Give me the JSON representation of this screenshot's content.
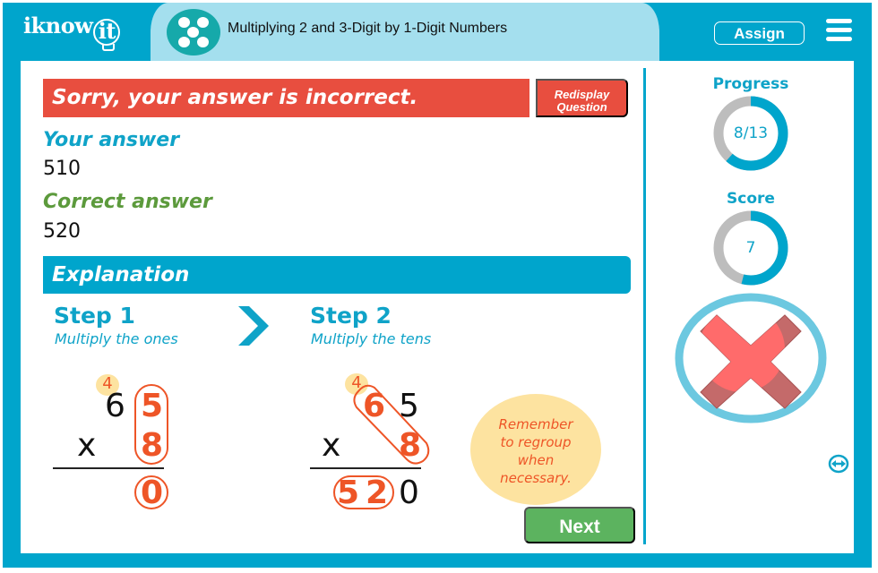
{
  "header": {
    "logo_text": "iknow",
    "logo_bulb_text": "it",
    "topic_title": "Multiplying 2 and 3-Digit by 1-Digit Numbers",
    "topic_icon": "five-dots-icon",
    "assign_label": "Assign",
    "menu_icon": "hamburger-menu-icon"
  },
  "feedback": {
    "banner_text": "Sorry, your answer is incorrect.",
    "redisplay_label_line1": "Redisplay",
    "redisplay_label_line2": "Question",
    "your_answer_label": "Your answer",
    "your_answer_value": "510",
    "correct_answer_label": "Correct answer",
    "correct_answer_value": "520"
  },
  "explanation": {
    "title": "Explanation",
    "steps": [
      {
        "title": "Step 1",
        "subtitle": "Multiply the ones",
        "carry": "4",
        "top_digits": [
          "6",
          "5"
        ],
        "operator": "x",
        "bottom_digit": "8",
        "result_digits": [
          "0"
        ]
      },
      {
        "title": "Step 2",
        "subtitle": "Multiply the tens",
        "carry": "4",
        "top_digits": [
          "6",
          "5"
        ],
        "operator": "x",
        "bottom_digit": "8",
        "result_digits": [
          "5",
          "2",
          "0"
        ]
      }
    ],
    "reminder_lines": [
      "Remember",
      "to regroup",
      "when",
      "necessary."
    ]
  },
  "navigation": {
    "next_label": "Next"
  },
  "sidebar": {
    "progress_label": "Progress",
    "progress_text": "8/13",
    "progress_fraction": 0.615,
    "score_label": "Score",
    "score_text": "7",
    "score_fraction": 0.54,
    "result_icon": "incorrect-x-icon",
    "resize_icon": "resize-horizontal-icon"
  },
  "colors": {
    "brand_teal": "#00a5cc",
    "title_pill": "#a4dfee",
    "error_red": "#e84e3f",
    "correct_green": "#5c9a3c",
    "next_green": "#5cb35f",
    "highlight_orange": "#ee5527",
    "reminder_yellow": "#fde3a0",
    "ring_gray": "#bdbdbd"
  }
}
